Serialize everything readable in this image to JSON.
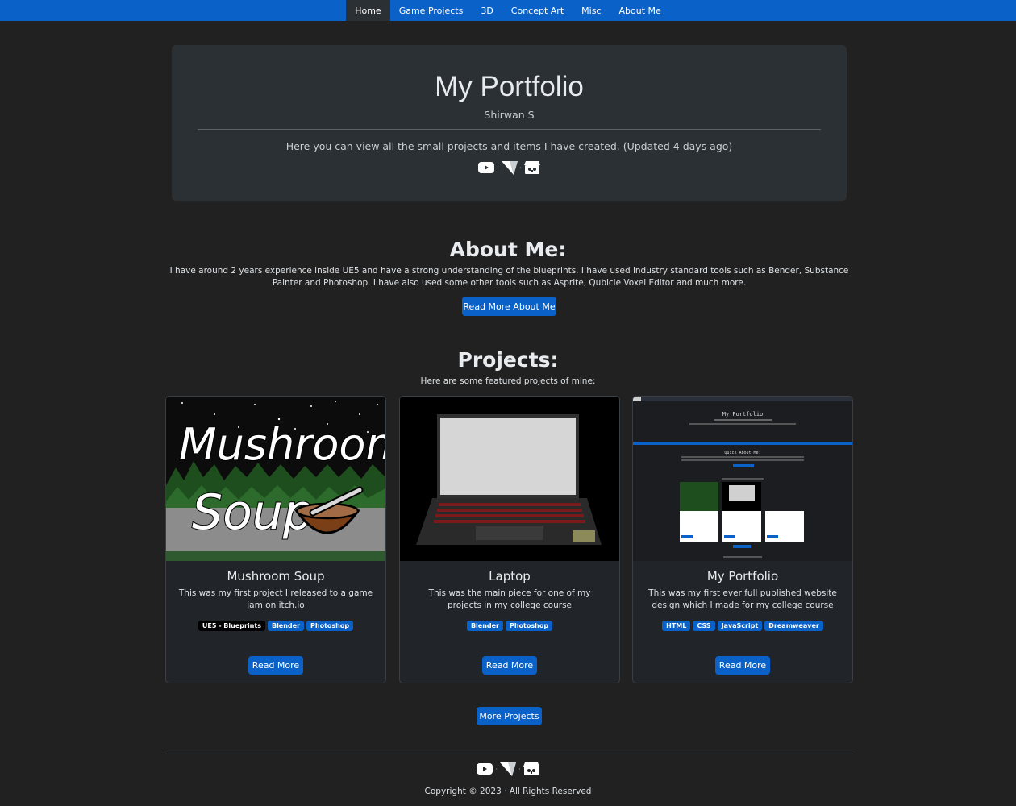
{
  "nav": {
    "items": [
      {
        "label": "Home",
        "active": true
      },
      {
        "label": "Game Projects"
      },
      {
        "label": "3D"
      },
      {
        "label": "Concept Art"
      },
      {
        "label": "Misc"
      },
      {
        "label": "About Me"
      }
    ]
  },
  "hero": {
    "title": "My Portfolio",
    "subtitle": "Shirwan S",
    "description": "Here you can view all the small projects and items I have created. (Updated 4 days ago)",
    "separator": "·"
  },
  "social_icons": [
    "youtube-icon",
    "vector-logo-icon",
    "itch-io-icon"
  ],
  "about": {
    "title": "About Me:",
    "text": "I have around 2 years experience inside UE5 and have a strong understanding of the blueprints. I have used industry standard tools such as Bender, Substance Painter and Photoshop. I have also used some other tools such as Asprite, Qubicle Voxel Editor and much more.",
    "button": "Read More About Me"
  },
  "projects": {
    "title": "Projects:",
    "subtitle": "Here are some featured projects of mine:",
    "more_button": "More Projects",
    "cards": [
      {
        "title": "Mushroom Soup",
        "text": "This was my first project I released to a game jam on itch.io",
        "badges": [
          {
            "label": "UE5 - Blueprints",
            "color": "#000000"
          },
          {
            "label": "Blender",
            "color": "#0a62c9"
          },
          {
            "label": "Photoshop",
            "color": "#0a62c9"
          }
        ],
        "button": "Read More",
        "image_text": [
          "Mushroom",
          "Soup"
        ]
      },
      {
        "title": "Laptop",
        "text": "This was the main piece for one of my projects in my college course",
        "badges": [
          {
            "label": "Blender",
            "color": "#0a62c9"
          },
          {
            "label": "Photoshop",
            "color": "#0a62c9"
          }
        ],
        "button": "Read More"
      },
      {
        "title": "My Portfolio",
        "text": "This was my first ever full published website design which I made for my college course",
        "badges": [
          {
            "label": "HTML",
            "color": "#0a62c9"
          },
          {
            "label": "CSS",
            "color": "#0a62c9"
          },
          {
            "label": "JavaScript",
            "color": "#0a62c9"
          },
          {
            "label": "Dreamweaver",
            "color": "#0a62c9"
          }
        ],
        "button": "Read More",
        "image_text": [
          "My Portfolio",
          "Quick About Me:"
        ]
      }
    ]
  },
  "footer": {
    "copyright": "Copyright © 2023 · All Rights Reserved"
  },
  "colors": {
    "accent": "#0a62c9",
    "background": "#212121",
    "panel": "#2b3035"
  }
}
